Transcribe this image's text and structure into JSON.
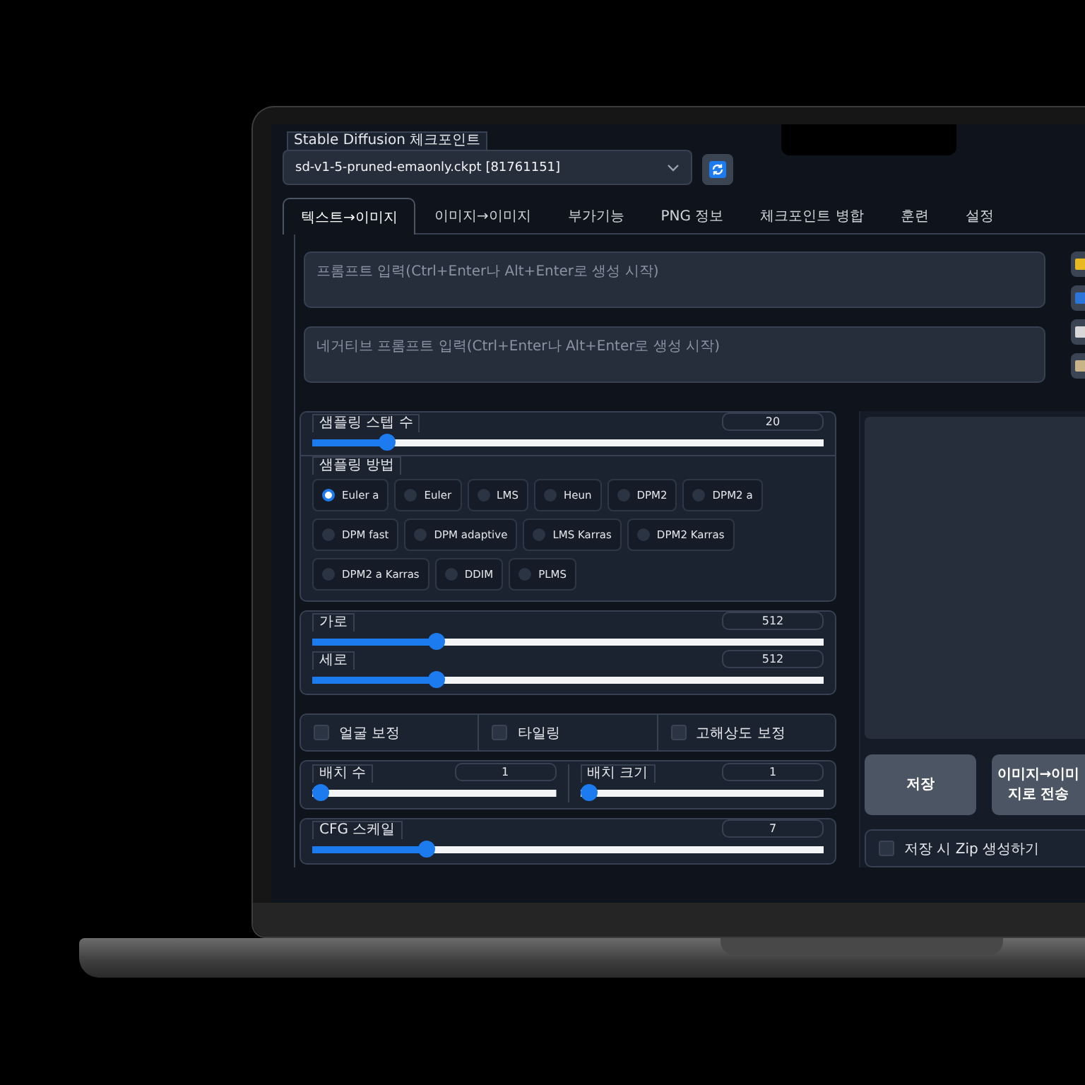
{
  "checkpoint": {
    "label": "Stable Diffusion 체크포인트",
    "value": "sd-v1-5-pruned-emaonly.ckpt [81761151]"
  },
  "tabs": [
    {
      "label": "텍스트→이미지",
      "selected": true
    },
    {
      "label": "이미지→이미지",
      "selected": false
    },
    {
      "label": "부가기능",
      "selected": false
    },
    {
      "label": "PNG 정보",
      "selected": false
    },
    {
      "label": "체크포인트 병합",
      "selected": false
    },
    {
      "label": "훈련",
      "selected": false
    },
    {
      "label": "설정",
      "selected": false
    }
  ],
  "prompts": [
    {
      "placeholder": "프롬프트 입력(Ctrl+Enter나 Alt+Enter로 생성 시작)"
    },
    {
      "placeholder": "네거티브 프롬프트 입력(Ctrl+Enter나 Alt+Enter로 생성 시작)"
    }
  ],
  "steps": {
    "label": "샘플링 스텝 수",
    "value": "20",
    "level": 0.135
  },
  "sampler": {
    "label": "샘플링 방법",
    "options": [
      {
        "label": "Euler a",
        "selected": true
      },
      {
        "label": "Euler",
        "selected": false
      },
      {
        "label": "LMS",
        "selected": false
      },
      {
        "label": "Heun",
        "selected": false
      },
      {
        "label": "DPM2",
        "selected": false
      },
      {
        "label": "DPM2 a",
        "selected": false
      },
      {
        "label": "DPM fast",
        "selected": false
      },
      {
        "label": "DPM adaptive",
        "selected": false
      },
      {
        "label": "LMS Karras",
        "selected": false
      },
      {
        "label": "DPM2 Karras",
        "selected": false
      },
      {
        "label": "DPM2 a Karras",
        "selected": false
      },
      {
        "label": "DDIM",
        "selected": false
      },
      {
        "label": "PLMS",
        "selected": false
      }
    ]
  },
  "size": [
    {
      "label": "가로",
      "value": "512",
      "level": 0.233
    },
    {
      "label": "세로",
      "value": "512",
      "level": 0.233
    }
  ],
  "options": [
    {
      "label": "얼굴 보정",
      "checked": false
    },
    {
      "label": "타일링",
      "checked": false
    },
    {
      "label": "고해상도 보정",
      "checked": false
    }
  ],
  "batch": [
    {
      "label": "배치 수",
      "value": "1",
      "level": 0
    },
    {
      "label": "배치 크기",
      "value": "1",
      "level": 0
    }
  ],
  "cfg": {
    "label": "CFG 스케일",
    "value": "7",
    "level": 0.213
  },
  "output": {
    "buttons": [
      "저장",
      "이미지→이미지로 전송"
    ],
    "zip": {
      "label": "저장 시 Zip 생성하기",
      "checked": false
    }
  }
}
